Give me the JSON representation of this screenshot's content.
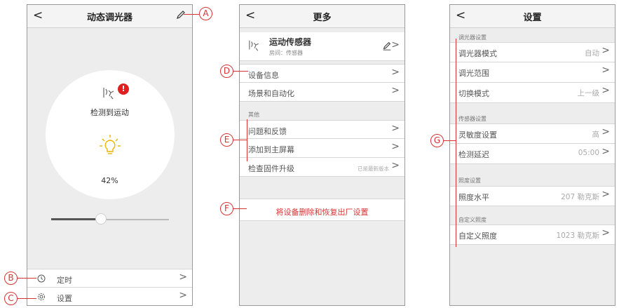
{
  "screen1": {
    "title": "动态调光器",
    "back": "<",
    "status": "检测到运动",
    "alert": "!",
    "level": "42%",
    "slider_fraction": 0.42,
    "rows": [
      {
        "label": "定时",
        "chevron": ">"
      },
      {
        "label": "设置",
        "chevron": ">"
      }
    ]
  },
  "screen2": {
    "title": "更多",
    "back": "<",
    "device_name": "运动传感器",
    "device_room": "房间：传感器",
    "rows1": [
      {
        "label": "设备信息",
        "chevron": ">"
      },
      {
        "label": "场景和自动化",
        "chevron": ">"
      }
    ],
    "section_other": "其他",
    "rows2": [
      {
        "label": "问题和反馈",
        "chevron": ">"
      },
      {
        "label": "添加到主屏幕",
        "chevron": ">"
      },
      {
        "label": "检查固件升级",
        "value": "已是最新版本",
        "chevron": ">"
      }
    ],
    "delete_label": "将设备删除和恢复出厂设置"
  },
  "screen3": {
    "title": "设置",
    "back": "<",
    "sections": [
      {
        "header": "调光器设置",
        "rows": [
          {
            "label": "调光器模式",
            "value": "自动"
          },
          {
            "label": "调光范围",
            "value": ""
          },
          {
            "label": "切换模式",
            "value": "上一级"
          }
        ]
      },
      {
        "header": "传感器设置",
        "rows": [
          {
            "label": "灵敏度设置",
            "value": "高"
          },
          {
            "label": "检测延迟",
            "value": "05:00"
          }
        ]
      },
      {
        "header": "照度设置",
        "rows": [
          {
            "label": "照度水平",
            "value": "207 勒克斯"
          }
        ]
      },
      {
        "header": "自定义照度",
        "rows": [
          {
            "label": "自定义照度",
            "value": "1023 勒克斯"
          }
        ]
      }
    ],
    "chevron": ">"
  },
  "callouts": {
    "a": "A",
    "b": "B",
    "c": "C",
    "d": "D",
    "e": "E",
    "f": "F",
    "g": "G"
  },
  "colors": {
    "accent_red": "#d83333",
    "bulb_yellow": "#f0b400"
  }
}
